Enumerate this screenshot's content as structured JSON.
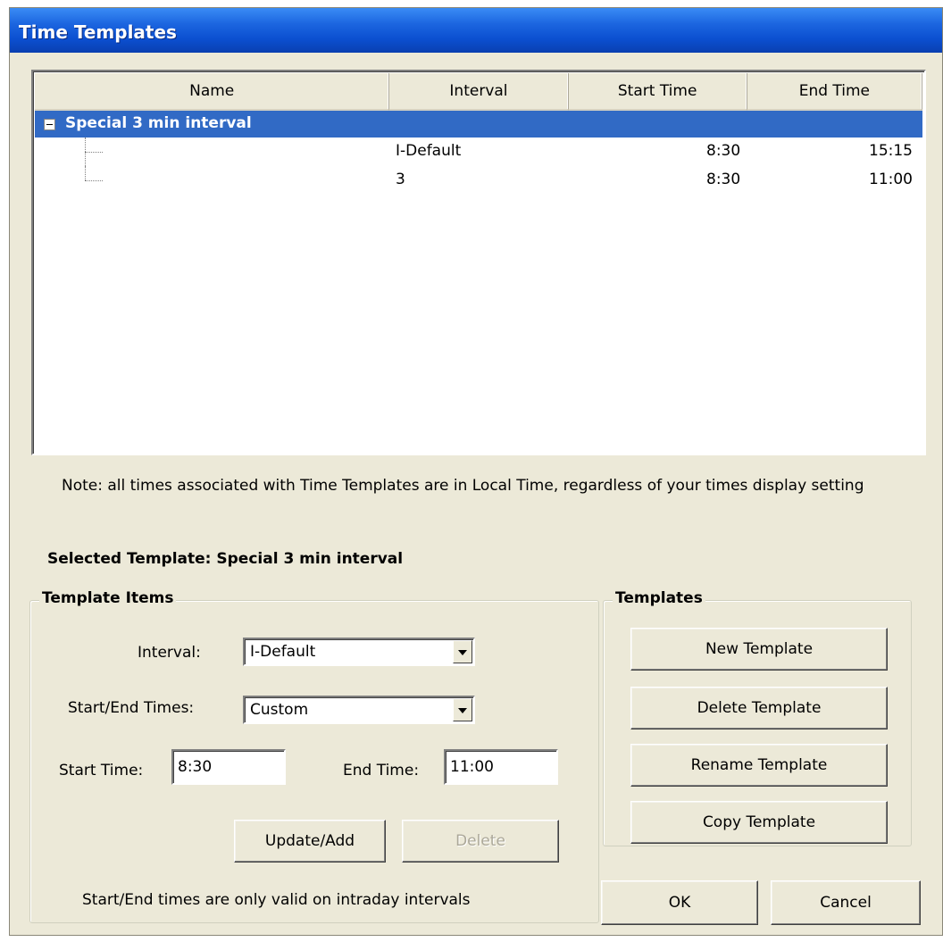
{
  "window": {
    "title": "Time Templates"
  },
  "list": {
    "columns": [
      "Name",
      "Interval",
      "Start Time",
      "End Time"
    ],
    "template_name": "Special 3 min interval",
    "items": [
      {
        "interval": "I-Default",
        "start": "8:30",
        "end": "15:15"
      },
      {
        "interval": "3",
        "start": "8:30",
        "end": "11:00"
      }
    ]
  },
  "note": "Note: all times associated with Time Templates are in Local Time, regardless of your times display setting",
  "selected_template": "Selected Template: Special 3 min interval",
  "template_items": {
    "title": "Template Items",
    "interval_label": "Interval:",
    "interval_value": "I-Default",
    "times_label": "Start/End Times:",
    "times_value": "Custom",
    "start_label": "Start Time:",
    "start_value": "8:30",
    "end_label": "End Time:",
    "end_value": "11:00",
    "update_button": "Update/Add",
    "delete_button": "Delete",
    "footnote": "Start/End times are only valid on intraday intervals"
  },
  "templates": {
    "title": "Templates",
    "new_button": "New Template",
    "delete_button": "Delete Template",
    "rename_button": "Rename Template",
    "copy_button": "Copy Template"
  },
  "buttons": {
    "ok": "OK",
    "cancel": "Cancel"
  }
}
